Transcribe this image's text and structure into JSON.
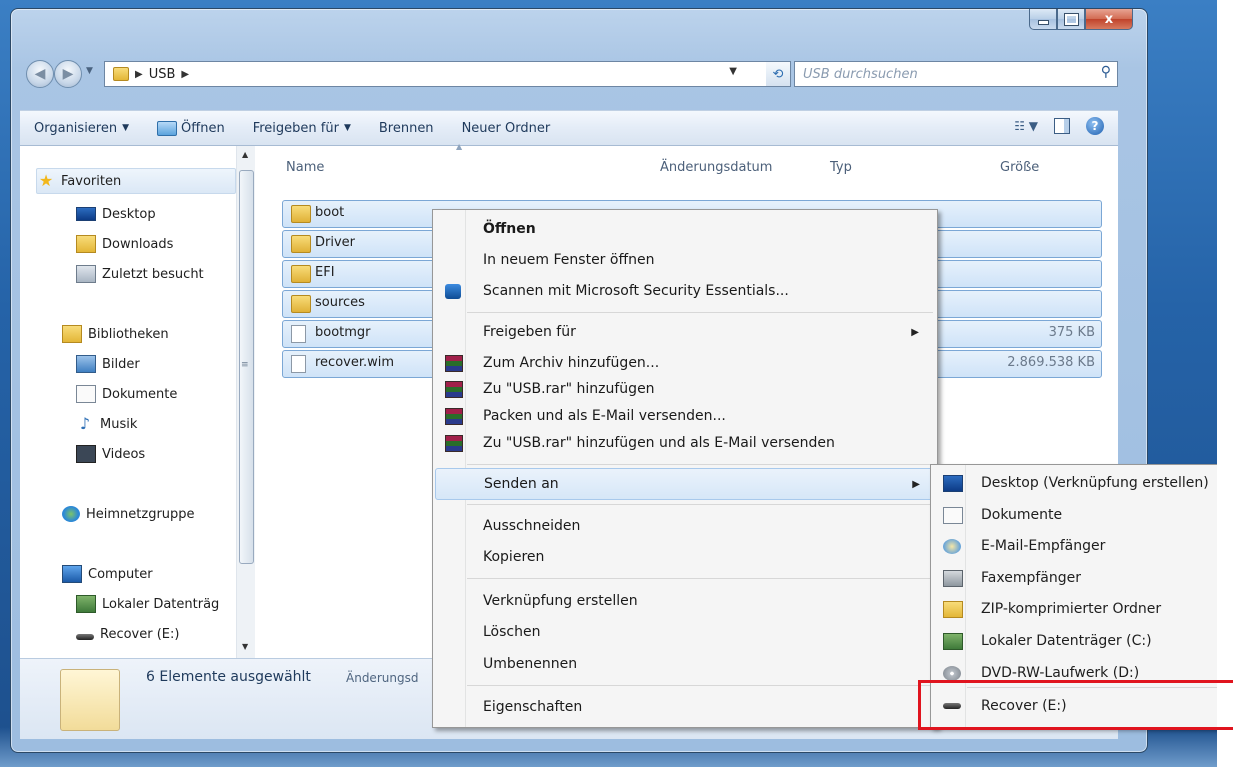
{
  "window": {
    "close_glyph": "x"
  },
  "address": {
    "crumb": "USB",
    "search_placeholder": "USB durchsuchen"
  },
  "toolbar": {
    "organize": "Organisieren",
    "open": "Öffnen",
    "share": "Freigeben für",
    "burn": "Brennen",
    "new_folder": "Neuer Ordner"
  },
  "navpane": {
    "favorites": "Favoriten",
    "desktop": "Desktop",
    "downloads": "Downloads",
    "recent": "Zuletzt besucht",
    "libraries": "Bibliotheken",
    "pictures": "Bilder",
    "documents": "Dokumente",
    "music": "Musik",
    "videos": "Videos",
    "homegroup": "Heimnetzgruppe",
    "computer": "Computer",
    "local_disk": "Lokaler Datenträg",
    "recover": "Recover (E:)"
  },
  "columns": {
    "name": "Name",
    "modified": "Änderungsdatum",
    "type": "Typ",
    "size": "Größe"
  },
  "files": [
    {
      "name": "boot",
      "kind": "folder",
      "size": ""
    },
    {
      "name": "Driver",
      "kind": "folder",
      "size": ""
    },
    {
      "name": "EFI",
      "kind": "folder",
      "size": ""
    },
    {
      "name": "sources",
      "kind": "folder",
      "size": ""
    },
    {
      "name": "bootmgr",
      "kind": "file",
      "size": "375 KB"
    },
    {
      "name": "recover.wim",
      "kind": "file",
      "size": "2.869.538 KB"
    }
  ],
  "status": {
    "selected": "6 Elemente ausgewählt",
    "sub": "Änderungsd"
  },
  "context_menu": {
    "open": "Öffnen",
    "open_new_window": "In neuem Fenster öffnen",
    "scan": "Scannen mit Microsoft Security Essentials...",
    "share": "Freigeben für",
    "add_archive": "Zum Archiv hinzufügen...",
    "add_usb_rar": "Zu \"USB.rar\" hinzufügen",
    "pack_email": "Packen und als E-Mail versenden...",
    "add_usb_rar_email": "Zu \"USB.rar\" hinzufügen und als E-Mail versenden",
    "send_to": "Senden an",
    "cut": "Ausschneiden",
    "copy": "Kopieren",
    "create_shortcut": "Verknüpfung erstellen",
    "delete": "Löschen",
    "rename": "Umbenennen",
    "properties": "Eigenschaften"
  },
  "send_to_menu": {
    "desktop": "Desktop (Verknüpfung erstellen)",
    "documents": "Dokumente",
    "mail": "E-Mail-Empfänger",
    "fax": "Faxempfänger",
    "zip": "ZIP-komprimierter Ordner",
    "local_disk": "Lokaler Datenträger (C:)",
    "dvd": "DVD-RW-Laufwerk (D:)",
    "recover": "Recover (E:)"
  },
  "colors": {
    "highlight_box": "#e0141e",
    "selection": "#cfe3f8"
  }
}
